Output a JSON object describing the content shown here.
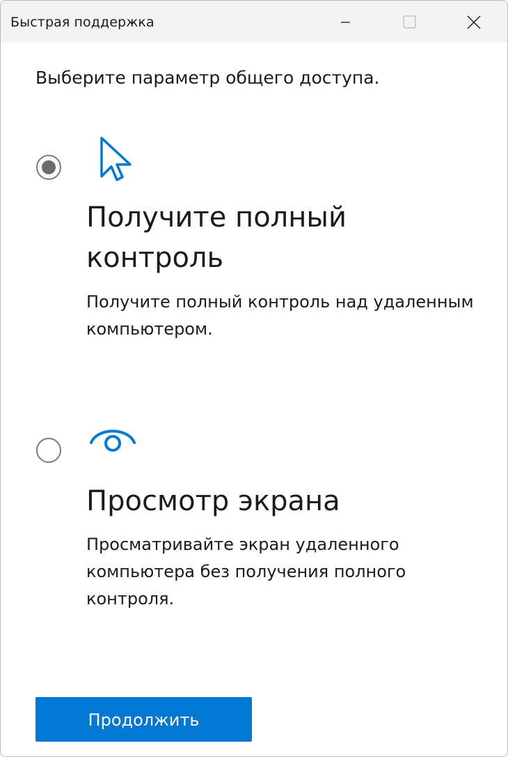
{
  "window": {
    "title": "Быстрая поддержка"
  },
  "prompt": "Выберите параметр общего доступа.",
  "options": [
    {
      "selected": true,
      "icon": "cursor-arrow-icon",
      "title": "Получите полный контроль",
      "description": "Получите полный контроль над удаленным компьютером."
    },
    {
      "selected": false,
      "icon": "eye-icon",
      "title": "Просмотр экрана",
      "description": "Просматривайте экран удаленного компьютера без получения полного контроля."
    }
  ],
  "continue_label": "Продолжить",
  "colors": {
    "accent": "#0078d4",
    "titlebar": "#f3f3f3",
    "radio_selected": "#6b6b6b",
    "text": "#1b1b1b"
  }
}
